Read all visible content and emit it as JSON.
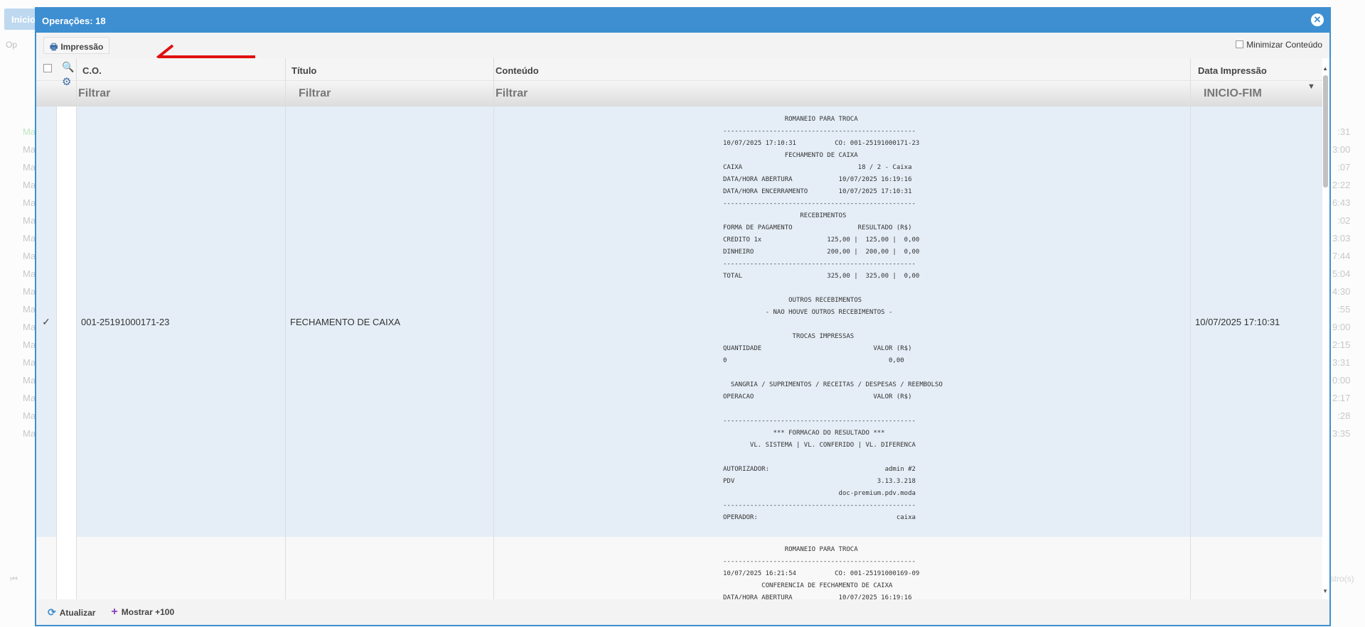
{
  "background": {
    "tab_label": "Inicio",
    "toolbar_label": "Op",
    "list_items": [
      "Ma",
      "Ma",
      "Ma",
      "Ma",
      "Ma",
      "Ma",
      "Ma",
      "Ma",
      "Ma",
      "Ma",
      "Ma",
      "Ma",
      "Ma",
      "Ma",
      "Ma",
      "Ma",
      "Ma",
      "Ma"
    ],
    "list_times": [
      ":31",
      "3:00",
      ":07",
      "2:22",
      "6:43",
      ":02",
      "3:03",
      "7:44",
      "5:04",
      "4:30",
      ":55",
      "9:00",
      "2:15",
      "3:31",
      "0:00",
      "2:17",
      ":28",
      "3:35"
    ],
    "footer_right": "istro(s)"
  },
  "modal": {
    "title": "Operações: 18",
    "close_icon": "close-icon",
    "toolbar": {
      "print_label": "Impressão",
      "minimize_label": "Minimizar Conteúdo"
    },
    "columns": {
      "co": "C.O.",
      "title": "Título",
      "content": "Conteúdo",
      "date": "Data Impressão"
    },
    "filters": {
      "co": "Filtrar",
      "title": "Filtrar",
      "content": "Filtrar",
      "date": "INICIO-FIM"
    },
    "rows": [
      {
        "co": "001-25191000171-23",
        "title": "FECHAMENTO DE CAIXA",
        "date": "10/07/2025 17:10:31",
        "selected": true,
        "content": "                ROMANEIO PARA TROCA\n--------------------------------------------------\n10/07/2025 17:10:31          CO: 001-25191000171-23\n                FECHAMENTO DE CAIXA\nCAIXA                              18 / 2 - Caixa\nDATA/HORA ABERTURA            10/07/2025 16:19:16\nDATA/HORA ENCERRAMENTO        10/07/2025 17:10:31\n--------------------------------------------------\n                    RECEBIMENTOS\nFORMA DE PAGAMENTO                 RESULTADO (R$)\nCREDITO 1x                 125,00 |  125,00 |  0,00\nDINHEIRO                   200,00 |  200,00 |  0,00\n--------------------------------------------------\nTOTAL                      325,00 |  325,00 |  0,00\n\n                 OUTROS RECEBIMENTOS\n           - NAO HOUVE OUTROS RECEBIMENTOS -\n\n                  TROCAS IMPRESSAS\nQUANTIDADE                             VALOR (R$)\n0                                          0,00\n\n  SANGRIA / SUPRIMENTOS / RECEITAS / DESPESAS / REEMBOLSO\nOPERACAO                               VALOR (R$)\n\n--------------------------------------------------\n             *** FORMACAO DO RESULTADO ***\n       VL. SISTEMA | VL. CONFERIDO | VL. DIFERENCA\n\nAUTORIZADOR:                              admin #2\nPDV                                     3.13.3.218\n                              doc-premium.pdv.moda\n--------------------------------------------------\nOPERADOR:                                    caixa"
      },
      {
        "co": "",
        "title": "",
        "date": "",
        "selected": false,
        "content": "                ROMANEIO PARA TROCA\n--------------------------------------------------\n10/07/2025 16:21:54          CO: 001-25191000169-09\n          CONFERENCIA DE FECHAMENTO DE CAIXA\nDATA/HORA ABERTURA            10/07/2025 16:19:16"
      }
    ],
    "footer": {
      "refresh_label": "Atualizar",
      "more_label": "Mostrar +100"
    }
  },
  "colors": {
    "accent": "#3d8fd1",
    "selected_row": "#e5eef7",
    "arrow": "#e01010"
  }
}
